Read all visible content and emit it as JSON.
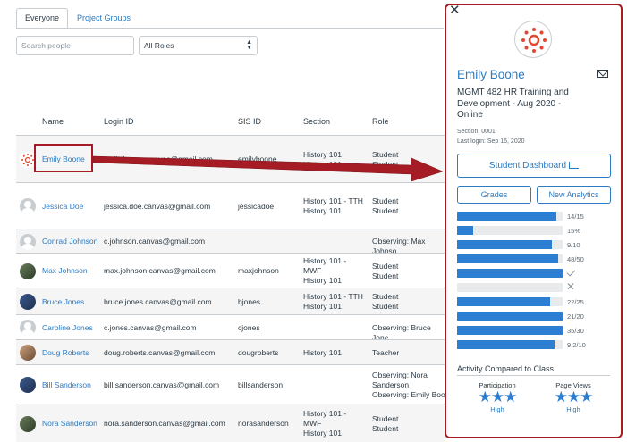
{
  "tabs": [
    {
      "label": "Everyone",
      "active": true
    },
    {
      "label": "Project Groups",
      "active": false
    }
  ],
  "filters": {
    "search_placeholder": "Search people",
    "role_select": "All Roles"
  },
  "table": {
    "headers": {
      "name": "Name",
      "login": "Login ID",
      "sis": "SIS ID",
      "section": "Section",
      "role": "Role"
    },
    "rows": [
      {
        "avatar": "canvas-logo",
        "name": "Emily Boone",
        "login": "emily.boone.canvas@gmail.com",
        "sis": "emilyboone",
        "section": [
          "History 101",
          "History 101 -"
        ],
        "role": [
          "Student",
          "Student"
        ]
      },
      {
        "avatar": "default",
        "name": "Jessica Doe",
        "login": "jessica.doe.canvas@gmail.com",
        "sis": "jessicadoe",
        "section": [
          "History 101 - TTH",
          "History 101"
        ],
        "role": [
          "Student",
          "Student"
        ]
      },
      {
        "avatar": "default",
        "name": "Conrad Johnson",
        "login": "c.johnson.canvas@gmail.com",
        "sis": "",
        "section": [],
        "role": [
          "Observing: Max Johnso"
        ]
      },
      {
        "avatar": "photo",
        "name": "Max Johnson",
        "login": "max.johnson.canvas@gmail.com",
        "sis": "maxjohnson",
        "section": [
          "History 101 -",
          "MWF",
          "History 101"
        ],
        "role": [
          "Student",
          "Student"
        ]
      },
      {
        "avatar": "photo2",
        "name": "Bruce Jones",
        "login": "bruce.jones.canvas@gmail.com",
        "sis": "bjones",
        "section": [
          "History 101 - TTH",
          "History 101"
        ],
        "role": [
          "Student",
          "Student"
        ]
      },
      {
        "avatar": "default",
        "name": "Caroline Jones",
        "login": "c.jones.canvas@gmail.com",
        "sis": "cjones",
        "section": [],
        "role": [
          "Observing: Bruce Jone"
        ]
      },
      {
        "avatar": "photo3",
        "name": "Doug Roberts",
        "login": "doug.roberts.canvas@gmail.com",
        "sis": "dougroberts",
        "section": [
          "History 101"
        ],
        "role": [
          "Teacher"
        ]
      },
      {
        "avatar": "photo2",
        "name": "Bill Sanderson",
        "login": "bill.sanderson.canvas@gmail.com",
        "sis": "billsanderson",
        "section": [],
        "role": [
          "Observing: Nora",
          "Sanderson",
          "Observing: Emily Boo"
        ]
      },
      {
        "avatar": "photo",
        "name": "Nora Sanderson",
        "login": "nora.sanderson.canvas@gmail.com",
        "sis": "norasanderson",
        "section": [
          "History 101 -",
          "MWF",
          "History 101"
        ],
        "role": [
          "Student",
          "Student"
        ]
      }
    ]
  },
  "panel": {
    "close": "✕",
    "name": "Emily Boone",
    "course": "MGMT 482 HR Training and Development - Aug 2020 - Online",
    "section": "Section: 0001",
    "last_login": "Last login: Sep 16, 2020",
    "dashboard_button": "Student Dashboard",
    "grades_button": "Grades",
    "analytics_button": "New Analytics",
    "grades": [
      {
        "label": "14/15",
        "fill": 0.94
      },
      {
        "label": "15%",
        "fill": 0.15
      },
      {
        "label": "9/10",
        "fill": 0.9
      },
      {
        "label": "48/50",
        "fill": 0.96
      },
      {
        "label": "",
        "fill": 1.0,
        "mark": "check"
      },
      {
        "label": "",
        "fill": 0.0,
        "mark": "x"
      },
      {
        "label": "22/25",
        "fill": 0.88
      },
      {
        "label": "21/20",
        "fill": 1.0
      },
      {
        "label": "35/30",
        "fill": 1.0
      },
      {
        "label": "9.2/10",
        "fill": 0.92
      }
    ],
    "activity_title": "Activity Compared to Class",
    "participation": {
      "label": "Participation",
      "stars": "★★★",
      "level": "High"
    },
    "page_views": {
      "label": "Page Views",
      "stars": "★★★",
      "level": "High"
    }
  },
  "colors": {
    "accent": "#2d7bc0",
    "highlight": "#a51c24",
    "bar": "#2b7ed1"
  }
}
